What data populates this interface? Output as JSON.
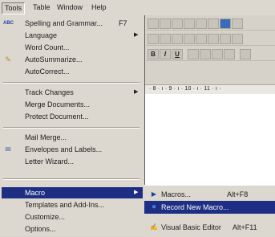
{
  "menubar": {
    "items": [
      "Tools",
      "Table",
      "Window",
      "Help"
    ]
  },
  "tools_menu": {
    "items": [
      {
        "label": "Spelling and Grammar...",
        "shortcut": "F7",
        "icon": "spelling-abc-icon"
      },
      {
        "label": "Language",
        "submenu": true
      },
      {
        "label": "Word Count..."
      },
      {
        "label": "AutoSummarize...",
        "icon": "autosummarize-icon"
      },
      {
        "label": "AutoCorrect..."
      },
      {
        "label": "Track Changes",
        "submenu": true
      },
      {
        "label": "Merge Documents..."
      },
      {
        "label": "Protect Document..."
      },
      {
        "label": "Mail Merge..."
      },
      {
        "label": "Envelopes and Labels...",
        "icon": "envelope-icon"
      },
      {
        "label": "Letter Wizard..."
      },
      {
        "label": "Macro",
        "submenu": true,
        "highlighted": true
      },
      {
        "label": "Templates and Add-Ins..."
      },
      {
        "label": "Customize..."
      },
      {
        "label": "Options..."
      }
    ]
  },
  "macro_submenu": {
    "items": [
      {
        "label": "Macros...",
        "shortcut": "Alt+F8",
        "icon": "play-arrow-icon"
      },
      {
        "label": "Record New Macro...",
        "icon": "record-dot-icon",
        "highlighted": true
      },
      {
        "label": "Visual Basic Editor",
        "shortcut": "Alt+F11",
        "icon": "vb-editor-icon"
      }
    ]
  },
  "toolbar": {
    "bold": "B",
    "italic": "I",
    "underline": "U"
  },
  "ruler": {
    "text": "· 8 · ı · 9 · ı · 10 · ı · 11 · ı ·"
  },
  "colors": {
    "menu_background": "#dcd8d0",
    "highlight": "#1e2e84",
    "document": "#ffffff"
  }
}
